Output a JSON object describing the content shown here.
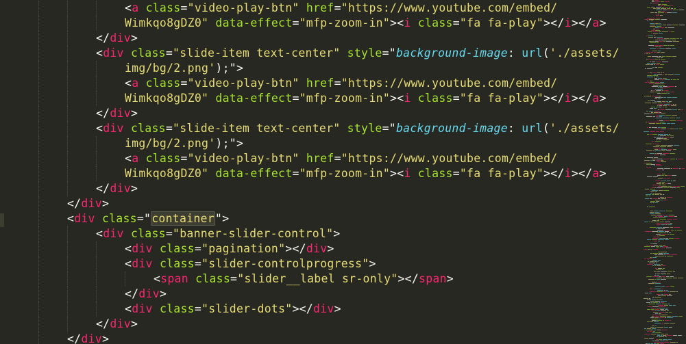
{
  "editor": {
    "theme_colors": {
      "background": "#272822",
      "tag": "#f92672",
      "attribute": "#a6e22e",
      "string": "#e6db74",
      "punctuation": "#f8f8f2",
      "support": "#66d9ef"
    },
    "lines": [
      {
        "indent": 4,
        "tokens": [
          [
            "p",
            "<"
          ],
          [
            "t",
            "a"
          ],
          [
            "p",
            " "
          ],
          [
            "a",
            "class"
          ],
          [
            "p",
            "="
          ],
          [
            "s",
            "\"video-play-btn\""
          ],
          [
            "p",
            " "
          ],
          [
            "a",
            "href"
          ],
          [
            "p",
            "="
          ],
          [
            "s",
            "\"https://www.youtube.com/embed/"
          ]
        ]
      },
      {
        "indent": 4,
        "tokens": [
          [
            "s",
            "Wimkqo8gDZ0\""
          ],
          [
            "p",
            " "
          ],
          [
            "a",
            "data-effect"
          ],
          [
            "p",
            "="
          ],
          [
            "s",
            "\"mfp-zoom-in\""
          ],
          [
            "p",
            "><"
          ],
          [
            "t",
            "i"
          ],
          [
            "p",
            " "
          ],
          [
            "a",
            "class"
          ],
          [
            "p",
            "="
          ],
          [
            "s",
            "\"fa fa-play\""
          ],
          [
            "p",
            "></"
          ],
          [
            "t",
            "i"
          ],
          [
            "p",
            "></"
          ],
          [
            "t",
            "a"
          ],
          [
            "p",
            ">"
          ]
        ]
      },
      {
        "indent": 3,
        "tokens": [
          [
            "p",
            "</"
          ],
          [
            "t",
            "div"
          ],
          [
            "p",
            ">"
          ]
        ]
      },
      {
        "indent": 3,
        "tokens": [
          [
            "p",
            "<"
          ],
          [
            "t",
            "div"
          ],
          [
            "p",
            " "
          ],
          [
            "a",
            "class"
          ],
          [
            "p",
            "="
          ],
          [
            "s",
            "\"slide-item text-center\""
          ],
          [
            "p",
            " "
          ],
          [
            "a",
            "style"
          ],
          [
            "p",
            "=\""
          ],
          [
            "st",
            "background-image"
          ],
          [
            "p",
            ": "
          ],
          [
            "f",
            "url"
          ],
          [
            "p",
            "("
          ],
          [
            "s",
            "'./assets/"
          ]
        ]
      },
      {
        "indent": 4,
        "tokens": [
          [
            "s",
            "img/bg/2.png'"
          ],
          [
            "p",
            ");\">"
          ]
        ]
      },
      {
        "indent": 4,
        "tokens": [
          [
            "p",
            "<"
          ],
          [
            "t",
            "a"
          ],
          [
            "p",
            " "
          ],
          [
            "a",
            "class"
          ],
          [
            "p",
            "="
          ],
          [
            "s",
            "\"video-play-btn\""
          ],
          [
            "p",
            " "
          ],
          [
            "a",
            "href"
          ],
          [
            "p",
            "="
          ],
          [
            "s",
            "\"https://www.youtube.com/embed/"
          ]
        ]
      },
      {
        "indent": 4,
        "tokens": [
          [
            "s",
            "Wimkqo8gDZ0\""
          ],
          [
            "p",
            " "
          ],
          [
            "a",
            "data-effect"
          ],
          [
            "p",
            "="
          ],
          [
            "s",
            "\"mfp-zoom-in\""
          ],
          [
            "p",
            "><"
          ],
          [
            "t",
            "i"
          ],
          [
            "p",
            " "
          ],
          [
            "a",
            "class"
          ],
          [
            "p",
            "="
          ],
          [
            "s",
            "\"fa fa-play\""
          ],
          [
            "p",
            "></"
          ],
          [
            "t",
            "i"
          ],
          [
            "p",
            "></"
          ],
          [
            "t",
            "a"
          ],
          [
            "p",
            ">"
          ]
        ]
      },
      {
        "indent": 3,
        "tokens": [
          [
            "p",
            "</"
          ],
          [
            "t",
            "div"
          ],
          [
            "p",
            ">"
          ]
        ]
      },
      {
        "indent": 3,
        "tokens": [
          [
            "p",
            "<"
          ],
          [
            "t",
            "div"
          ],
          [
            "p",
            " "
          ],
          [
            "a",
            "class"
          ],
          [
            "p",
            "="
          ],
          [
            "s",
            "\"slide-item text-center\""
          ],
          [
            "p",
            " "
          ],
          [
            "a",
            "style"
          ],
          [
            "p",
            "=\""
          ],
          [
            "st",
            "background-image"
          ],
          [
            "p",
            ": "
          ],
          [
            "f",
            "url"
          ],
          [
            "p",
            "("
          ],
          [
            "s",
            "'./assets/"
          ]
        ]
      },
      {
        "indent": 4,
        "tokens": [
          [
            "s",
            "img/bg/2.png'"
          ],
          [
            "p",
            ");\">"
          ]
        ]
      },
      {
        "indent": 4,
        "tokens": [
          [
            "p",
            "<"
          ],
          [
            "t",
            "a"
          ],
          [
            "p",
            " "
          ],
          [
            "a",
            "class"
          ],
          [
            "p",
            "="
          ],
          [
            "s",
            "\"video-play-btn\""
          ],
          [
            "p",
            " "
          ],
          [
            "a",
            "href"
          ],
          [
            "p",
            "="
          ],
          [
            "s",
            "\"https://www.youtube.com/embed/"
          ]
        ]
      },
      {
        "indent": 4,
        "tokens": [
          [
            "s",
            "Wimkqo8gDZ0\""
          ],
          [
            "p",
            " "
          ],
          [
            "a",
            "data-effect"
          ],
          [
            "p",
            "="
          ],
          [
            "s",
            "\"mfp-zoom-in\""
          ],
          [
            "p",
            "><"
          ],
          [
            "t",
            "i"
          ],
          [
            "p",
            " "
          ],
          [
            "a",
            "class"
          ],
          [
            "p",
            "="
          ],
          [
            "s",
            "\"fa fa-play\""
          ],
          [
            "p",
            "></"
          ],
          [
            "t",
            "i"
          ],
          [
            "p",
            "></"
          ],
          [
            "t",
            "a"
          ],
          [
            "p",
            ">"
          ]
        ]
      },
      {
        "indent": 3,
        "tokens": [
          [
            "p",
            "</"
          ],
          [
            "t",
            "div"
          ],
          [
            "p",
            ">"
          ]
        ]
      },
      {
        "indent": 2,
        "tokens": [
          [
            "p",
            "</"
          ],
          [
            "t",
            "div"
          ],
          [
            "p",
            ">"
          ]
        ]
      },
      {
        "indent": 2,
        "tokens": [
          [
            "p",
            "<"
          ],
          [
            "t",
            "div"
          ],
          [
            "p",
            " "
          ],
          [
            "a",
            "class"
          ],
          [
            "p",
            "=\""
          ],
          [
            "s",
            "container",
            "hl"
          ],
          [
            "p",
            "\">"
          ]
        ]
      },
      {
        "indent": 3,
        "tokens": [
          [
            "p",
            "<"
          ],
          [
            "t",
            "div"
          ],
          [
            "p",
            " "
          ],
          [
            "a",
            "class"
          ],
          [
            "p",
            "="
          ],
          [
            "s",
            "\"banner-slider-control\""
          ],
          [
            "p",
            ">"
          ]
        ]
      },
      {
        "indent": 4,
        "tokens": [
          [
            "p",
            "<"
          ],
          [
            "t",
            "div"
          ],
          [
            "p",
            " "
          ],
          [
            "a",
            "class"
          ],
          [
            "p",
            "="
          ],
          [
            "s",
            "\"pagination\""
          ],
          [
            "p",
            "></"
          ],
          [
            "t",
            "div"
          ],
          [
            "p",
            ">"
          ]
        ]
      },
      {
        "indent": 4,
        "tokens": [
          [
            "p",
            "<"
          ],
          [
            "t",
            "div"
          ],
          [
            "p",
            " "
          ],
          [
            "a",
            "class"
          ],
          [
            "p",
            "="
          ],
          [
            "s",
            "\"slider-controlprogress\""
          ],
          [
            "p",
            ">"
          ]
        ]
      },
      {
        "indent": 5,
        "tokens": [
          [
            "p",
            "<"
          ],
          [
            "t",
            "span"
          ],
          [
            "p",
            " "
          ],
          [
            "a",
            "class"
          ],
          [
            "p",
            "="
          ],
          [
            "s",
            "\"slider__label sr-only\""
          ],
          [
            "p",
            "></"
          ],
          [
            "t",
            "span"
          ],
          [
            "p",
            ">"
          ]
        ]
      },
      {
        "indent": 4,
        "tokens": [
          [
            "p",
            "</"
          ],
          [
            "t",
            "div"
          ],
          [
            "p",
            ">"
          ]
        ]
      },
      {
        "indent": 4,
        "tokens": [
          [
            "p",
            "<"
          ],
          [
            "t",
            "div"
          ],
          [
            "p",
            " "
          ],
          [
            "a",
            "class"
          ],
          [
            "p",
            "="
          ],
          [
            "s",
            "\"slider-dots\""
          ],
          [
            "p",
            "></"
          ],
          [
            "t",
            "div"
          ],
          [
            "p",
            ">"
          ]
        ]
      },
      {
        "indent": 3,
        "tokens": [
          [
            "p",
            "</"
          ],
          [
            "t",
            "div"
          ],
          [
            "p",
            ">"
          ]
        ]
      },
      {
        "indent": 2,
        "tokens": [
          [
            "p",
            "</"
          ],
          [
            "t",
            "div"
          ],
          [
            "p",
            ">"
          ]
        ]
      }
    ]
  }
}
